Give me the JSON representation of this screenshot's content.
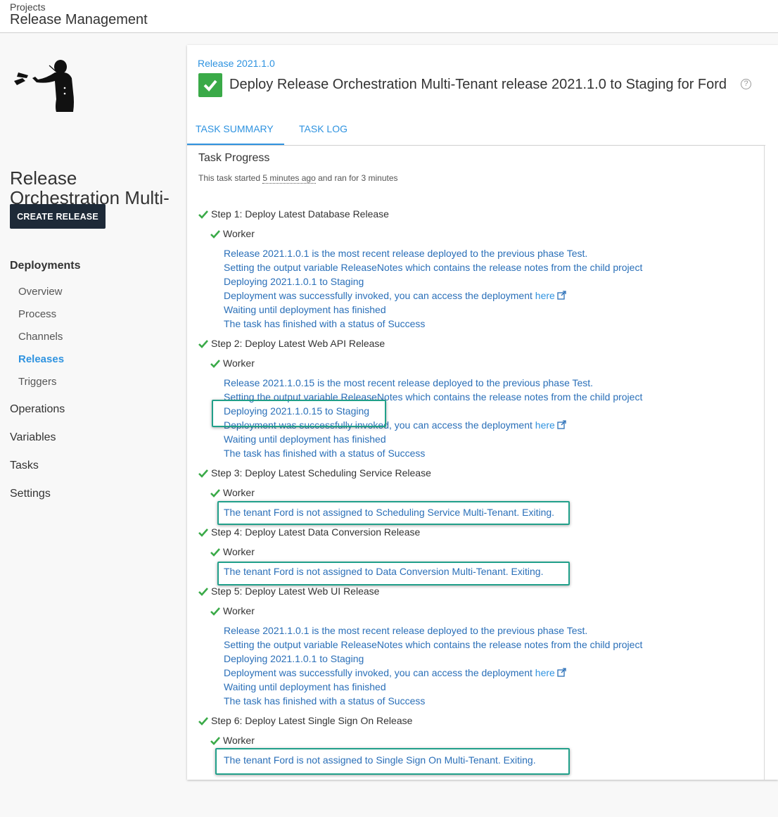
{
  "header": {
    "breadcrumb": "Projects",
    "title": "Release Management"
  },
  "sidebar": {
    "project_name": "Release Orchestration Multi-Tenant",
    "create_release_label": "CREATE RELEASE",
    "deployments_label": "Deployments",
    "deployment_items": [
      "Overview",
      "Process",
      "Channels",
      "Releases",
      "Triggers"
    ],
    "active_item": "Releases",
    "sections": [
      "Operations",
      "Variables",
      "Tasks",
      "Settings"
    ]
  },
  "task": {
    "release_link": "Release 2021.1.0",
    "title": "Deploy Release Orchestration Multi-Tenant release 2021.1.0 to Staging for Ford",
    "status_color": "#3aaa48",
    "tabs": [
      "TASK SUMMARY",
      "TASK LOG"
    ],
    "active_tab": "TASK SUMMARY",
    "progress_title": "Task Progress",
    "meta_prefix": "This task started",
    "meta_started": "5 minutes ago",
    "meta_suffix": "and ran for 3 minutes",
    "worker_label": "Worker",
    "link_word": "here",
    "steps": [
      {
        "title": "Step 1: Deploy Latest Database Release",
        "logs": [
          "Release 2021.1.0.1 is the most recent release deployed to the previous phase Test.",
          "Setting the output variable ReleaseNotes which contains the release notes from the child project",
          "Deploying 2021.1.0.1 to Staging",
          "Deployment was successfully invoked, you can access the deployment",
          "Waiting until deployment has finished",
          "The task has finished with a status of Success"
        ]
      },
      {
        "title": "Step 2: Deploy Latest Web API Release",
        "logs": [
          "Release 2021.1.0.15 is the most recent release deployed to the previous phase Test.",
          "Setting the output variable ReleaseNotes which contains the release notes from the child project",
          "Deploying 2021.1.0.15 to Staging",
          "Deployment was successfully invoked, you can access the deployment",
          "Waiting until deployment has finished",
          "The task has finished with a status of Success"
        ]
      },
      {
        "title": "Step 3: Deploy Latest Scheduling Service Release",
        "logs": [
          "The tenant Ford is not assigned to Scheduling Service Multi-Tenant. Exiting."
        ]
      },
      {
        "title": "Step 4: Deploy Latest Data Conversion Release",
        "logs": [
          "The tenant Ford is not assigned to Data Conversion Multi-Tenant. Exiting."
        ]
      },
      {
        "title": "Step 5: Deploy Latest Web UI Release",
        "logs": [
          "Release 2021.1.0.1 is the most recent release deployed to the previous phase Test.",
          "Setting the output variable ReleaseNotes which contains the release notes from the child project",
          "Deploying 2021.1.0.1 to Staging",
          "Deployment was successfully invoked, you can access the deployment",
          "Waiting until deployment has finished",
          "The task has finished with a status of Success"
        ]
      },
      {
        "title": "Step 6: Deploy Latest Single Sign On Release",
        "logs": [
          "The tenant Ford is not assigned to Single Sign On Multi-Tenant. Exiting."
        ]
      }
    ]
  },
  "highlight_color": "#21a08a"
}
